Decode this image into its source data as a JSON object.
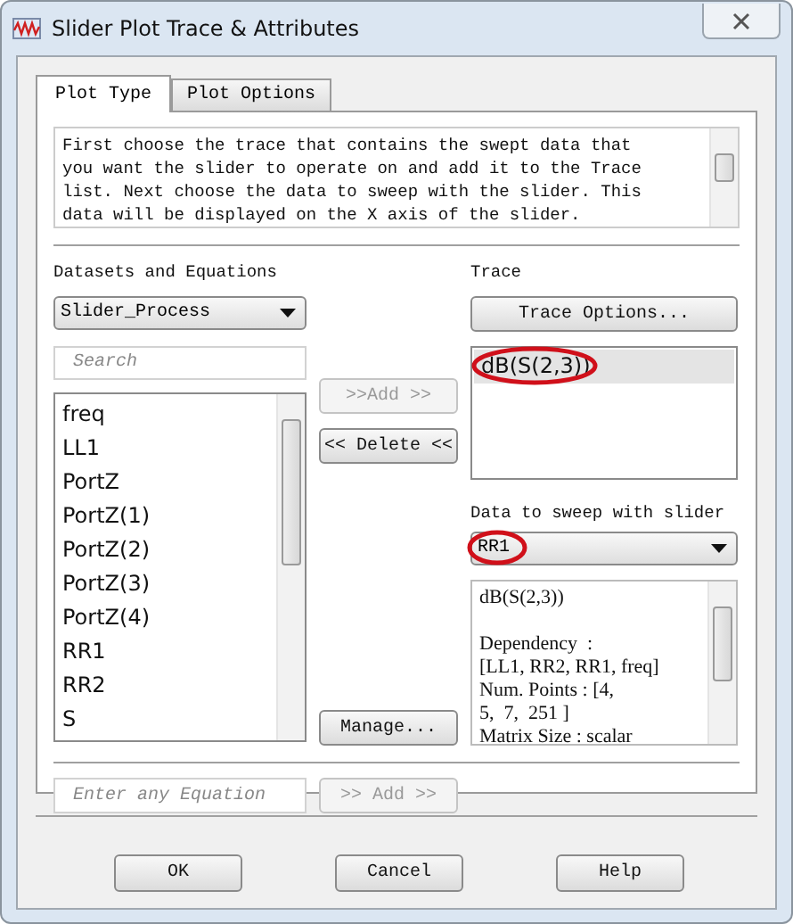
{
  "window": {
    "title": "Slider Plot Trace & Attributes"
  },
  "tabs": [
    {
      "label": "Plot Type",
      "selected": true
    },
    {
      "label": "Plot Options",
      "selected": false
    }
  ],
  "description": "First choose the trace that contains the swept data that\nyou want the slider to operate on and add it to the Trace\nlist. Next choose the data to sweep with the slider. This\ndata will be displayed on the X axis of the slider.",
  "datasets": {
    "label": "Datasets and Equations",
    "dataset": "Slider_Process",
    "search_placeholder": "Search",
    "items": [
      {
        "label": "freq",
        "selected": false
      },
      {
        "label": "LL1",
        "selected": false
      },
      {
        "label": "PortZ",
        "selected": false
      },
      {
        "label": "PortZ(1)",
        "selected": false
      },
      {
        "label": "PortZ(2)",
        "selected": false
      },
      {
        "label": "PortZ(3)",
        "selected": false
      },
      {
        "label": "PortZ(4)",
        "selected": false
      },
      {
        "label": "RR1",
        "selected": false
      },
      {
        "label": "RR2",
        "selected": false
      },
      {
        "label": "S",
        "selected": false
      }
    ],
    "equation_placeholder": "Enter any Equation"
  },
  "middle_buttons": [
    {
      "label": ">>Add >>",
      "disabled": true
    },
    {
      "label": "<< Delete <<",
      "disabled": false
    }
  ],
  "manage_button": {
    "label": "Manage...",
    "disabled": false
  },
  "equation_add_button": {
    "label": ">> Add >>",
    "disabled": true
  },
  "trace": {
    "label": "Trace",
    "options_button": "Trace Options...",
    "items": [
      {
        "label": "dB(S(2,3))",
        "selected": true,
        "circled": true
      }
    ]
  },
  "sweep": {
    "label": "Data to sweep with slider",
    "value": "RR1",
    "circled": true,
    "info": "dB(S(2,3))\n\nDependency  :\n[LL1, RR2, RR1, freq]\nNum. Points : [4,\n5,  7,  251 ]\nMatrix Size : scalar"
  },
  "buttons": [
    {
      "label": "OK"
    },
    {
      "label": "Cancel"
    },
    {
      "label": "Help"
    }
  ]
}
